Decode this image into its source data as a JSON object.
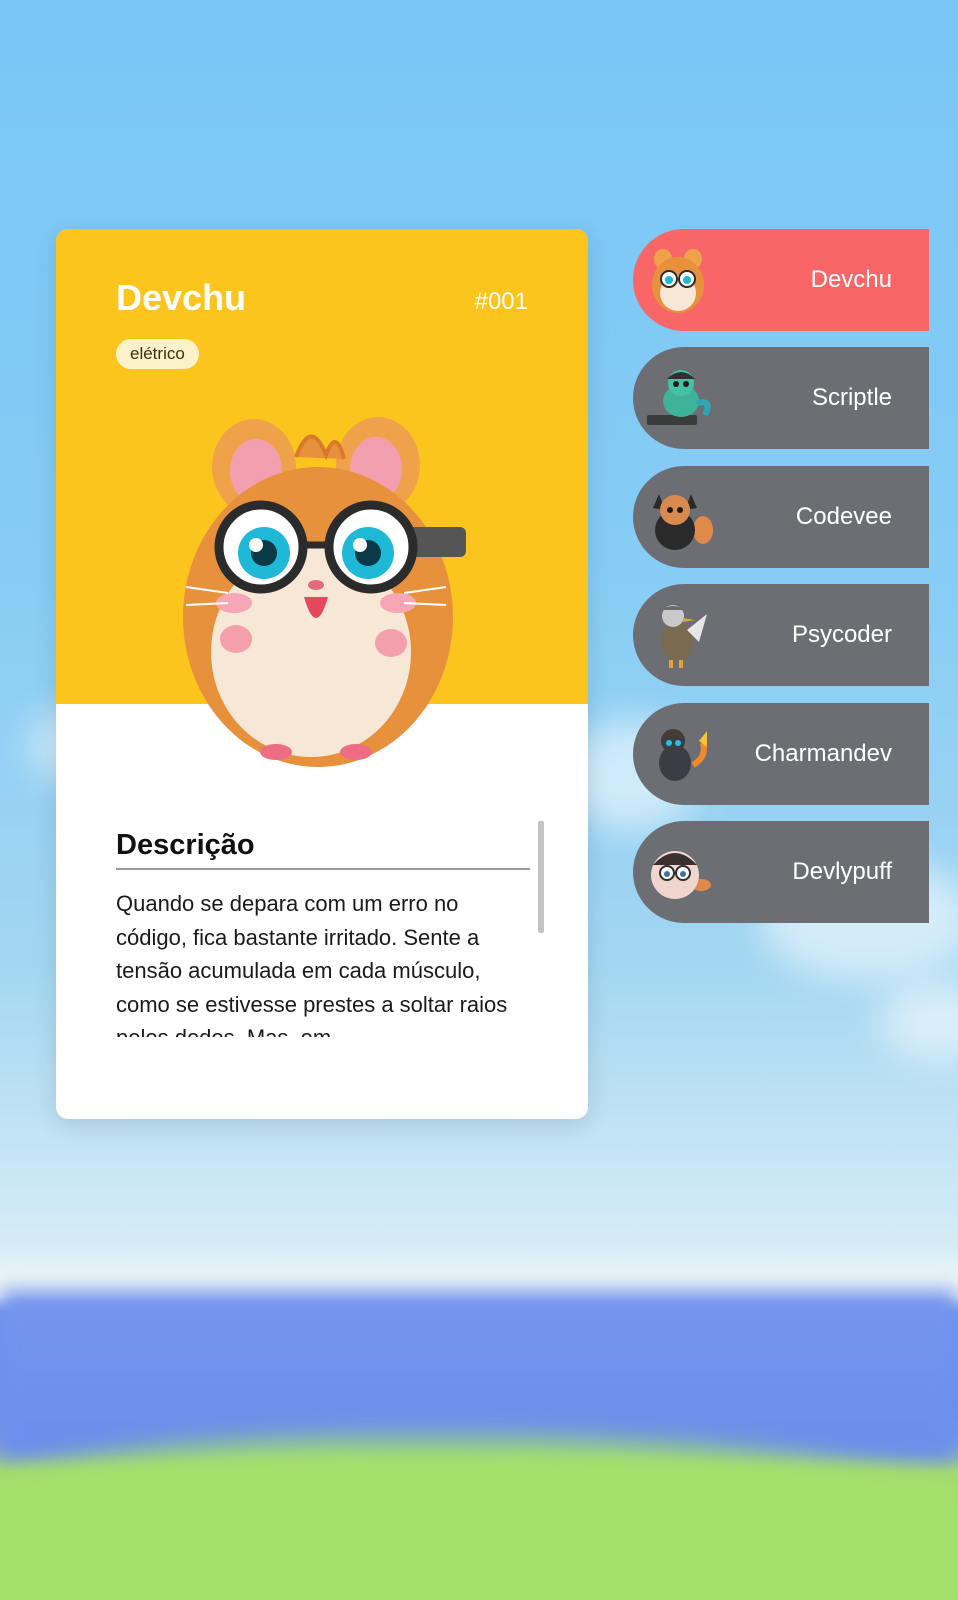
{
  "card": {
    "name": "Devchu",
    "number": "#001",
    "type_badge": "elétrico",
    "description_title": "Descrição",
    "description_text": "Quando se depara com um erro no código, fica bastante irritado. Sente a tensão acumulada em cada músculo, como se estivesse prestes a soltar raios pelos dedos. Mas, em",
    "top_color": "#fcc51d"
  },
  "characters": [
    {
      "name": "Devchu",
      "active": true,
      "color": "#f86667",
      "icon": "hamster-icon"
    },
    {
      "name": "Scriptle",
      "active": false,
      "color": "#6c6e73",
      "icon": "turtle-icon"
    },
    {
      "name": "Codevee",
      "active": false,
      "color": "#6c6e73",
      "icon": "fox-icon"
    },
    {
      "name": "Psycoder",
      "active": false,
      "color": "#6c6e73",
      "icon": "duck-icon"
    },
    {
      "name": "Charmandev",
      "active": false,
      "color": "#6c6e73",
      "icon": "lizard-icon"
    },
    {
      "name": "Devlypuff",
      "active": false,
      "color": "#6c6e73",
      "icon": "puff-icon"
    }
  ]
}
